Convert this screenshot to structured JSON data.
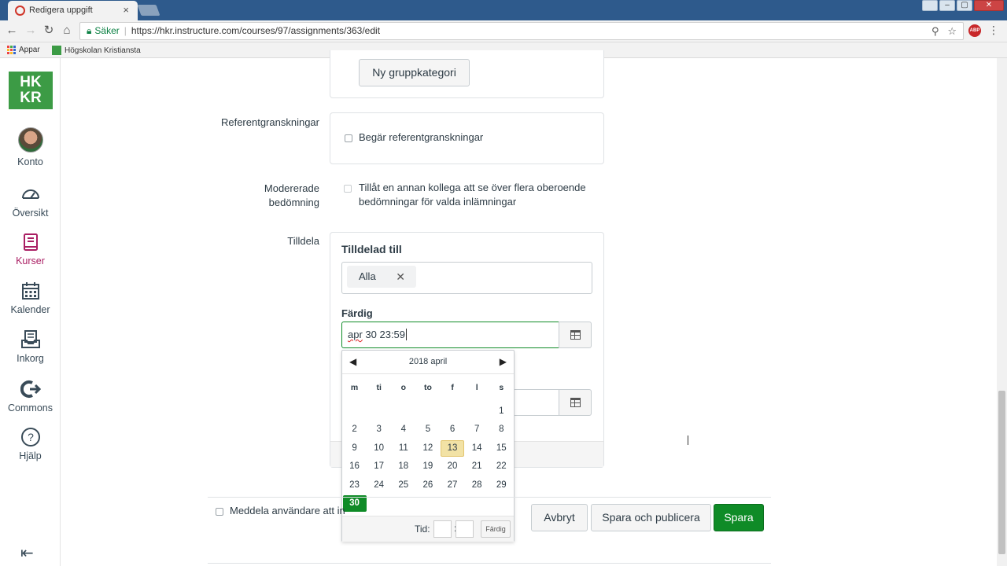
{
  "browser": {
    "tab_title": "Redigera uppgift",
    "tab_close": "×",
    "secure_label": "Säker",
    "url": "https://hkr.instructure.com/courses/97/assignments/363/edit",
    "bookmarks": [
      "Appar",
      "Högskolan Kristiansta"
    ],
    "window_controls": [
      "–",
      "▢",
      "✕"
    ],
    "abp_label": "ABP"
  },
  "nav": {
    "logo": "HK KR",
    "items": [
      {
        "label": "Konto",
        "icon": "account-avatar"
      },
      {
        "label": "Översikt",
        "icon": "dashboard-icon"
      },
      {
        "label": "Kurser",
        "icon": "courses-icon"
      },
      {
        "label": "Kalender",
        "icon": "calendar-icon"
      },
      {
        "label": "Inkorg",
        "icon": "inbox-icon"
      },
      {
        "label": "Commons",
        "icon": "commons-icon"
      },
      {
        "label": "Hjälp",
        "icon": "help-icon"
      }
    ]
  },
  "form": {
    "group_button": "Ny gruppkategori",
    "peer_review_label": "Referentgranskningar",
    "peer_review_checkbox": "Begär referentgranskningar",
    "moderated_label_1": "Modererade",
    "moderated_label_2": "bedömning",
    "moderated_text_1": "Tillåt en annan kollega att se över flera oberoende",
    "moderated_text_2": "bedömningar för valda inlämningar",
    "assign_label": "Tilldela",
    "assigned_to_title": "Tilldelad till",
    "assignee_pill": "Alla",
    "pill_remove": "✕",
    "due_label": "Färdig",
    "due_value_spelled": "apr",
    "due_value_rest": " 30 23:59",
    "notify_label": "Meddela användare att in",
    "cancel_button": "Avbryt",
    "save_publish_button": "Spara och publicera",
    "save_button": "Spara"
  },
  "datepicker": {
    "title": "2018 april",
    "prev": "◀",
    "next": "▶",
    "weekdays": [
      "m",
      "ti",
      "o",
      "to",
      "f",
      "l",
      "s"
    ],
    "weeks": [
      [
        "",
        "",
        "",
        "",
        "",
        "",
        "1"
      ],
      [
        "2",
        "3",
        "4",
        "5",
        "6",
        "7",
        "8"
      ],
      [
        "9",
        "10",
        "11",
        "12",
        "13",
        "14",
        "15"
      ],
      [
        "16",
        "17",
        "18",
        "19",
        "20",
        "21",
        "22"
      ],
      [
        "23",
        "24",
        "25",
        "26",
        "27",
        "28",
        "29"
      ],
      [
        "30",
        "",
        "",
        "",
        "",
        "",
        ""
      ]
    ],
    "today": "13",
    "selected": "30",
    "time_label": "Tid:",
    "time_colon": ":",
    "done_button": "Färdig"
  },
  "colors": {
    "accent_green": "#0f8b27",
    "active_nav": "#aa1e63",
    "today_highlight": "#f2e2a5",
    "titlebar": "#2e5a8c"
  }
}
